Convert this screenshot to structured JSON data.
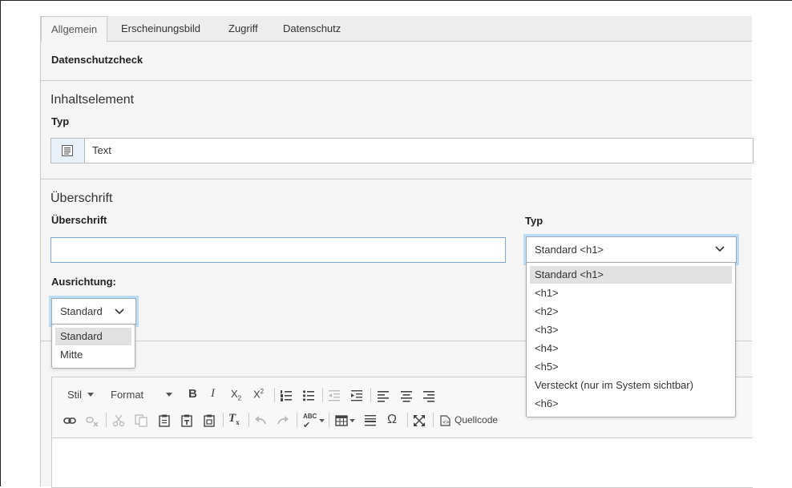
{
  "tabs": [
    "Allgemein",
    "Erscheinungsbild",
    "Zugriff",
    "Datenschutz"
  ],
  "datenschutzcheck": "Datenschutzcheck",
  "inhaltselement": {
    "section_title": "Inhaltselement",
    "typ_label": "Typ",
    "typ_value": "Text",
    "typ_icon": "text-document-icon"
  },
  "ueberschrift": {
    "section_title": "Überschrift",
    "field_label": "Überschrift",
    "field_value": "",
    "typ_label": "Typ",
    "typ_selected": "Standard <h1>",
    "typ_options": [
      "Standard <h1>",
      "<h1>",
      "<h2>",
      "<h3>",
      "<h4>",
      "<h5>",
      "Versteckt (nur im System sichtbar)",
      "<h6>"
    ],
    "ausrichtung_label": "Ausrichtung:",
    "ausrichtung_selected": "Standard",
    "ausrichtung_options": [
      "Standard",
      "Mitte"
    ]
  },
  "editor_toolbar": {
    "stil_label": "Stil",
    "format_label": "Format",
    "quellcode_label": "Quellcode"
  },
  "colors": {
    "focus_ring": "#bcdcf4",
    "selected_option": "#e1e1e1",
    "panel_bg": "#f5f5f5"
  }
}
